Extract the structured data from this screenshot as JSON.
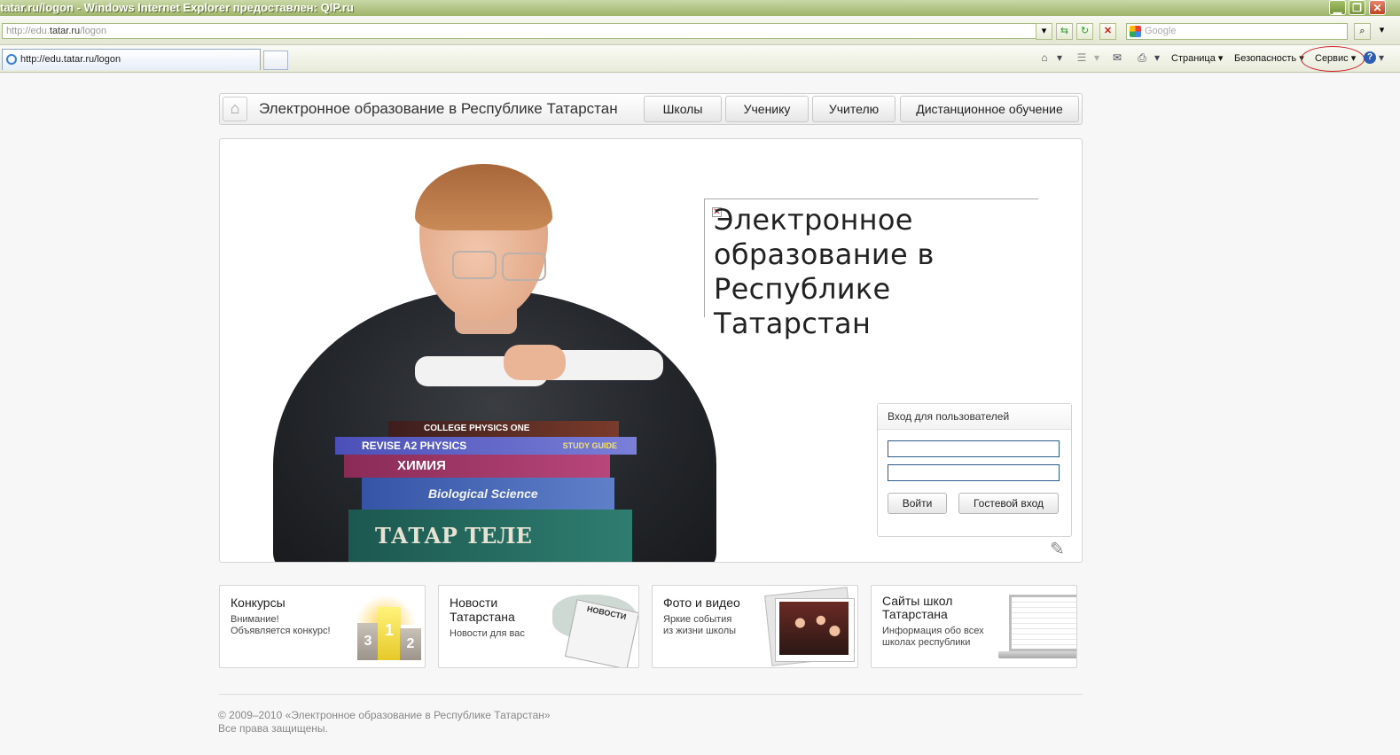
{
  "window": {
    "title": "tatar.ru/logon - Windows Internet Explorer предоставлен: QIP.ru",
    "min": "▁",
    "max": "❐",
    "close": "✕"
  },
  "address": {
    "prefix": "http://edu.",
    "domain": "tatar.ru",
    "path": "/logon"
  },
  "search": {
    "placeholder": "Google"
  },
  "tab": {
    "label": "http://edu.tatar.ru/logon"
  },
  "commands": {
    "page": "Страница ▾",
    "security": "Безопасность ▾",
    "service": "Сервис ▾"
  },
  "site": {
    "name": "Электронное образование в Республике Татарстан",
    "nav": [
      "Школы",
      "Ученику",
      "Учителю",
      "Дистанционное обучение"
    ],
    "hero_title": "Электронное образование в Республике Татарстан",
    "book_labels": [
      "COLLEGE PHYSICS ONE",
      "REVISE A2 PHYSICS",
      "STUDY GUIDE",
      "ХИМИЯ",
      "Biological Science",
      "ТАТАР ТЕЛЕ"
    ]
  },
  "login": {
    "header": "Вход для пользователей",
    "login_button": "Войти",
    "guest_button": "Гостевой вход"
  },
  "cards": [
    {
      "title": "Конкурсы",
      "sub1": "Внимание!",
      "sub2": "Объявляется конкурс!"
    },
    {
      "title1": "Новости",
      "title2": "Татарстана",
      "sub1": "Новости для вас",
      "badge": "НОВОСТИ"
    },
    {
      "title": "Фото и видео",
      "sub1": "Яркие события",
      "sub2": "из жизни школы"
    },
    {
      "title1": "Сайты школ",
      "title2": "Татарстана",
      "sub1": "Информация обо всех",
      "sub2": "школах республики"
    }
  ],
  "podium": [
    "3",
    "1",
    "2"
  ],
  "footer": {
    "line1": "© 2009–2010 «Электронное образование в Республике Татарстан»",
    "line2": "Все права защищены."
  }
}
